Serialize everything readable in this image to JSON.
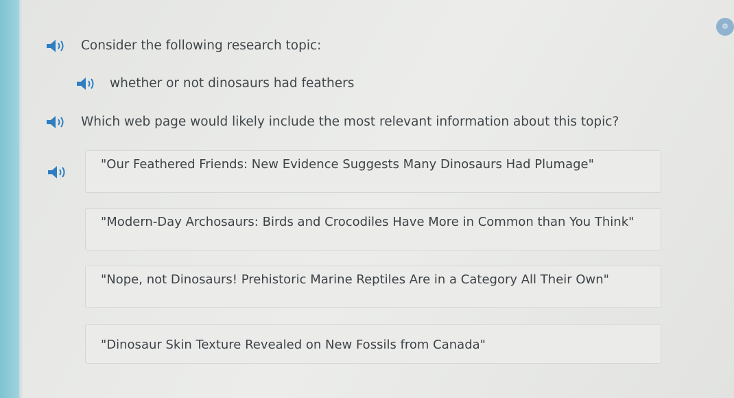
{
  "prompt": {
    "intro": "Consider the following research topic:",
    "topic": "whether or not dinosaurs had feathers",
    "question": "Which web page would likely include the most relevant information about this topic?"
  },
  "choices": [
    {
      "label": "\"Our Feathered Friends: New Evidence Suggests Many Dinosaurs Had Plumage\""
    },
    {
      "label": "\"Modern-Day Archosaurs: Birds and Crocodiles Have More in Common than You Think\""
    },
    {
      "label": "\"Nope, not Dinosaurs! Prehistoric Marine Reptiles Are in a Category All Their Own\""
    },
    {
      "label": "\"Dinosaur Skin Texture Revealed on New Fossils from Canada\""
    }
  ],
  "icons": {
    "audio": "speaker-icon",
    "corner": "settings-badge-icon"
  },
  "colors": {
    "accent_bar": "#7ec4d2",
    "speaker": "#2f7fc0",
    "badge": "#8fb2cf"
  }
}
